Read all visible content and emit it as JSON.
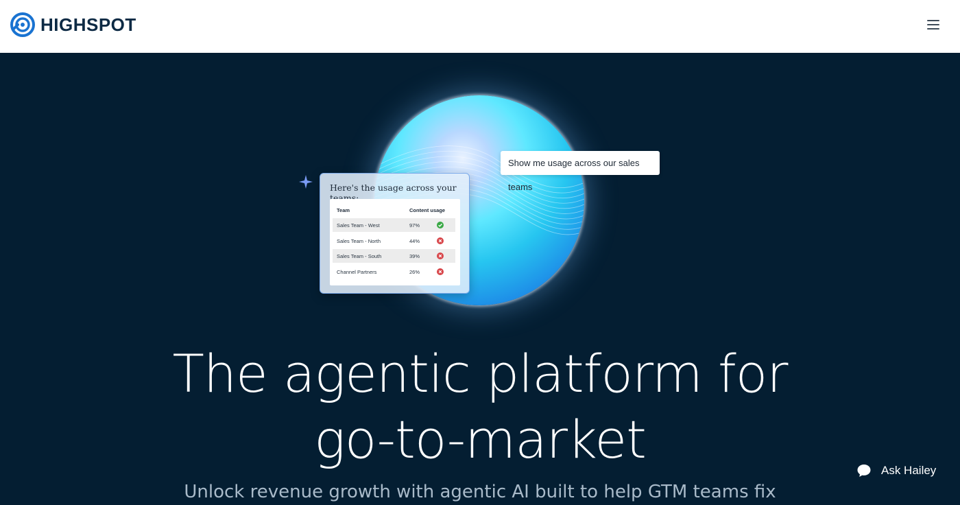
{
  "brand": {
    "name": "HIGHSPOT",
    "color": "#1a73d1"
  },
  "nav": {
    "menu_icon": "hamburger-menu-icon"
  },
  "hero": {
    "prompt": "Show me usage across our sales teams",
    "card_title": "Here's the usage across your teams:",
    "table": {
      "headers": [
        "Team",
        "Content usage"
      ],
      "rows": [
        {
          "team": "Sales Team - West",
          "usage": "97%",
          "status": "success"
        },
        {
          "team": "Sales Team - North",
          "usage": "44%",
          "status": "fail"
        },
        {
          "team": "Sales Team - South",
          "usage": "39%",
          "status": "fail"
        },
        {
          "team": "Channel Partners",
          "usage": "26%",
          "status": "fail"
        }
      ]
    },
    "headline_line1": "The agentic platform for",
    "headline_line2": "go-to-market",
    "subheadline": "Unlock revenue growth with agentic AI built to help GTM teams fix"
  },
  "chat_widget": {
    "label": "Ask Hailey",
    "icon": "chat-bubble-icon"
  },
  "colors": {
    "hero_bg": "#041e32",
    "success": "#3aa845",
    "fail": "#d8464a"
  }
}
